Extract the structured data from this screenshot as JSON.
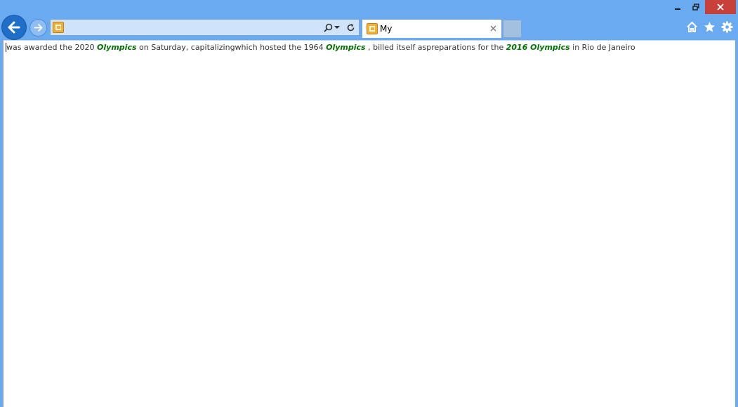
{
  "browser": {
    "address": {
      "value": "",
      "placeholder": ""
    },
    "tab": {
      "title": "My"
    },
    "icons": {
      "back": "back-arrow-icon",
      "forward": "forward-arrow-icon",
      "search": "search-icon",
      "dropdown": "dropdown-icon",
      "refresh": "refresh-icon",
      "close_tab": "close-icon",
      "home": "home-icon",
      "favorites": "star-icon",
      "settings": "gear-icon",
      "minimize": "minimize-icon",
      "restore": "restore-icon",
      "close_window": "close-icon"
    },
    "colors": {
      "frame": "#6aaaf0",
      "back_button": "#1f6fc8",
      "close_window": "#c7403a",
      "link_green": "#007200"
    }
  },
  "page": {
    "segments": [
      "was awarded the 2020 ",
      "Olympics",
      " on Saturday, capitalizingwhich hosted the 1964 ",
      "Olympics",
      " , billed itself aspreparations for the ",
      "2016 Olympics",
      " in Rio de Janeiro"
    ]
  }
}
